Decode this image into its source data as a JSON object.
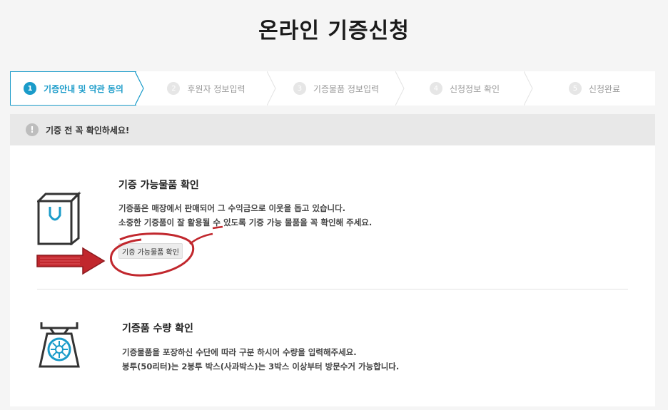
{
  "page": {
    "title": "온라인 기증신청"
  },
  "steps": [
    {
      "num": "1",
      "label": "기증안내 및 약관 동의",
      "active": true
    },
    {
      "num": "2",
      "label": "후원자 정보입력",
      "active": false
    },
    {
      "num": "3",
      "label": "기증물품 정보입력",
      "active": false
    },
    {
      "num": "4",
      "label": "신청정보 확인",
      "active": false
    },
    {
      "num": "5",
      "label": "신청완료",
      "active": false
    }
  ],
  "notice": {
    "icon": "exclamation-icon",
    "text": "기증 전 꼭 확인하세요!"
  },
  "section1": {
    "icon": "shopping-bag-icon",
    "title": "기증 가능물품 확인",
    "line1": "기증품은 매장에서 판매되어 그 수익금으로 이웃을 돕고 있습니다.",
    "line2": "소중한 기증품이 잘 활용될 수 있도록 기증 가능 물품을 꼭 확인해 주세요.",
    "button_label": "기증 가능물품 확인"
  },
  "section2": {
    "icon": "scale-icon",
    "title": "기증품 수량 확인",
    "line1": "기증물품을 포장하신 수단에 따라 구분 하시어 수량을 입력해주세요.",
    "line2": "봉투(50리터)는 2봉투 박스(사과박스)는 3박스 이상부터 방문수거 가능합니다."
  },
  "colors": {
    "accent": "#1a9bc9",
    "annotation": "#c1272d",
    "background": "#f5f5f5"
  }
}
